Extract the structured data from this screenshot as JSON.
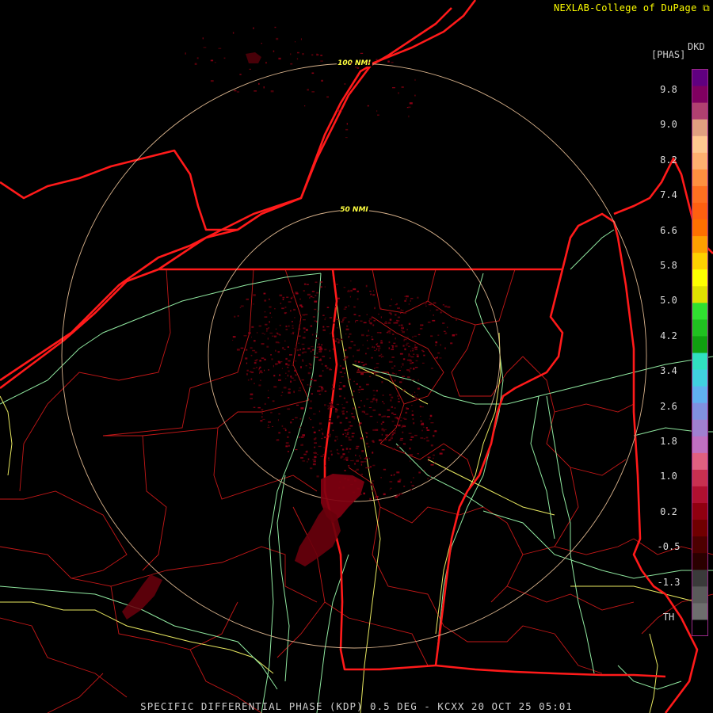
{
  "header": {
    "credit": "NEXLAB-College of DuPage"
  },
  "footer": {
    "caption": "SPECIFIC DIFFERENTIAL PHASE (KDP) 0.5 DEG - KCXX 20 OCT 25 05:01"
  },
  "range_rings": [
    {
      "label": "100 NMI"
    },
    {
      "label": "50 NMI"
    }
  ],
  "legend": {
    "product": "DKD",
    "units": "[PHAS]",
    "ticks": [
      "9.8",
      "9.0",
      "8.2",
      "7.4",
      "6.6",
      "5.8",
      "5.0",
      "4.2",
      "3.4",
      "2.6",
      "1.8",
      "1.0",
      "0.2",
      "-0.5",
      "-1.3",
      "TH"
    ],
    "colors": [
      "#000000",
      "#6e6e6e",
      "#5a5a5a",
      "#3a3a3a",
      "#2a0000",
      "#4d0000",
      "#700000",
      "#900010",
      "#b01030",
      "#c83050",
      "#e06080",
      "#c070c0",
      "#a080d0",
      "#8090e0",
      "#60b0f0",
      "#40d0e0",
      "#30e0c0",
      "#10a010",
      "#20c020",
      "#30e030",
      "#e0e000",
      "#ffff00",
      "#ffd000",
      "#ffa000",
      "#ff7000",
      "#ff6010",
      "#ff7020",
      "#ff9040",
      "#ffb070",
      "#ffc890",
      "#e0a080",
      "#b04070",
      "#800060",
      "#600080"
    ]
  },
  "colors": {
    "state_lines": "#ff1a1a",
    "county_lines": "#c81818",
    "roads_major": "#e8e860",
    "roads_minor": "#90e8a0",
    "range_ring": "#d9b38c",
    "ring_label": "#ffff40"
  }
}
